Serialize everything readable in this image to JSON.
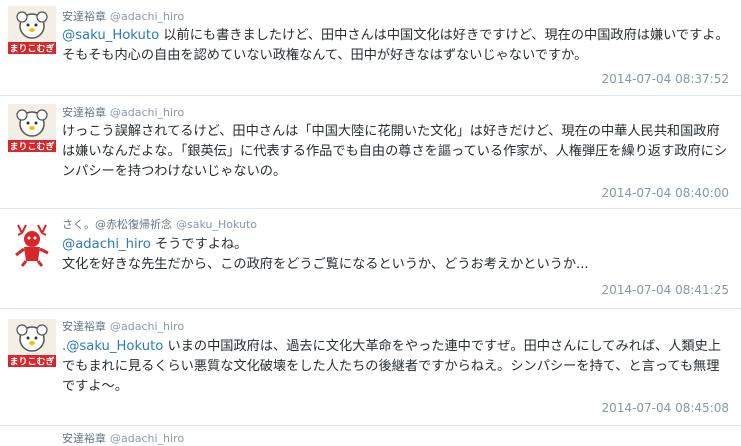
{
  "tweets": [
    {
      "name": "安達裕章",
      "handle": "@adachi_hiro",
      "avatar": "mariko-avatar",
      "mention": "@saku_Hokuto",
      "body": " 以前にも書きましたけど、田中さんは中国文化は好きですけど、現在の中国政府は嫌いですよ。そもそも内心の自由を認めていない政権なんて、田中が好きなはずないじゃないですか。",
      "timestamp": "2014-07-04 08:37:52"
    },
    {
      "name": "安達裕章",
      "handle": "@adachi_hiro",
      "avatar": "mariko-avatar",
      "mention": "",
      "body": "けっこう誤解されてるけど、田中さんは「中国大陸に花開いた文化」は好きだけど、現在の中華人民共和国政府は嫌いなんだよな。「銀英伝」に代表する作品でも自由の尊さを謳っている作家が、人権弾圧を繰り返す政府にシンパシーを持つわけないじゃないの。",
      "timestamp": "2014-07-04 08:40:00"
    },
    {
      "name": "さく。@赤松復帰祈念",
      "handle": "@saku_Hokuto",
      "avatar": "red-deer-avatar",
      "mention": "@adachi_hiro",
      "body": " そうですよね。",
      "body2": "文化を好きな先生だから、この政府をどうご覧になるというか、どうお考えかというか...",
      "timestamp": "2014-07-04 08:41:25"
    },
    {
      "name": "安達裕章",
      "handle": "@adachi_hiro",
      "avatar": "mariko-avatar",
      "mention": ".@saku_Hokuto",
      "body": " いまの中国政府は、過去に文化大革命をやった連中ですぜ。田中さんにしてみれば、人類史上でもまれに見るくらい悪質な文化破壊をした人たちの後継者ですからねえ。シンパシーを持て、と言っても無理ですよ〜。",
      "timestamp": "2014-07-04 08:45:08"
    },
    {
      "name": "安達裕章",
      "handle": "@adachi_hiro",
      "avatar": "mariko-avatar"
    }
  ],
  "avatar_label": "まりこむぎ",
  "colors": {
    "mention": "#2b7bb9",
    "meta": "#8899a6",
    "avatar_red": "#d9262b"
  }
}
